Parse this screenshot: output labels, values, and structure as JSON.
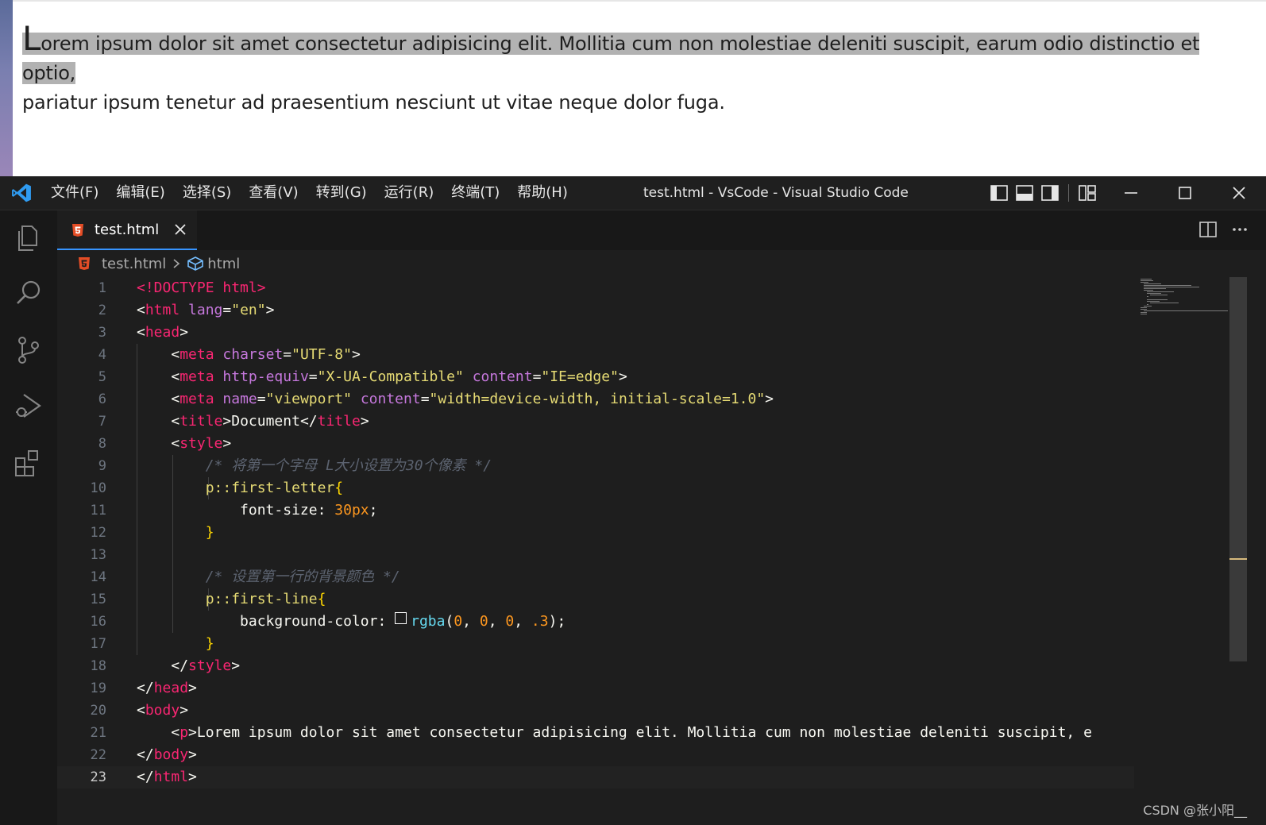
{
  "preview": {
    "first_letter": "L",
    "line1_rest": "orem ipsum dolor sit amet consectetur adipisicing elit. Mollitia cum non molestiae deleniti suscipit, earum odio distinctio et optio,",
    "line2": "pariatur ipsum tenetur ad praesentium nesciunt ut vitae neque dolor fuga."
  },
  "titlebar": {
    "menu": [
      "文件(F)",
      "编辑(E)",
      "选择(S)",
      "查看(V)",
      "转到(G)",
      "运行(R)",
      "终端(T)",
      "帮助(H)"
    ],
    "title": "test.html - VsCode - Visual Studio Code"
  },
  "tab": {
    "label": "test.html"
  },
  "breadcrumb": {
    "file": "test.html",
    "symbol": "html"
  },
  "code": {
    "line_numbers": [
      "1",
      "2",
      "3",
      "4",
      "5",
      "6",
      "7",
      "8",
      "9",
      "10",
      "11",
      "12",
      "13",
      "14",
      "15",
      "16",
      "17",
      "18",
      "19",
      "20",
      "21",
      "22",
      "23"
    ],
    "l1": "<!DOCTYPE html>",
    "l2_tag": "html",
    "l2_attr": "lang",
    "l2_val": "\"en\"",
    "l3_tag": "head",
    "l4_tag": "meta",
    "l4_attr": "charset",
    "l4_val": "\"UTF-8\"",
    "l5_tag": "meta",
    "l5_attr1": "http-equiv",
    "l5_val1": "\"X-UA-Compatible\"",
    "l5_attr2": "content",
    "l5_val2": "\"IE=edge\"",
    "l6_tag": "meta",
    "l6_attr1": "name",
    "l6_val1": "\"viewport\"",
    "l6_attr2": "content",
    "l6_val2": "\"width=device-width, initial-scale=1.0\"",
    "l7_tag": "title",
    "l7_text": "Document",
    "l8_tag": "style",
    "l9_comment": "/* 将第一个字母 L大小设置为30个像素 */",
    "l10_sel": "p::first-letter",
    "l11_prop": "font-size",
    "l11_val": "30px",
    "l14_comment": "/* 设置第一行的背景颜色 */",
    "l15_sel": "p::first-line",
    "l16_prop": "background-color",
    "l16_fn": "rgba",
    "l16_nums": [
      "0",
      "0",
      "0",
      ".3"
    ],
    "l18_tag": "style",
    "l19_tag": "head",
    "l20_tag": "body",
    "l21_tag": "p",
    "l21_text": "Lorem ipsum dolor sit amet consectetur adipisicing elit. Mollitia cum non molestiae deleniti suscipit, e",
    "l22_tag": "body",
    "l23_tag": "html"
  },
  "watermark": "CSDN @张小阳__",
  "colors": {
    "accent": "#3794ff",
    "editor_bg": "#1e1e1e",
    "activity_bg": "#181818"
  }
}
